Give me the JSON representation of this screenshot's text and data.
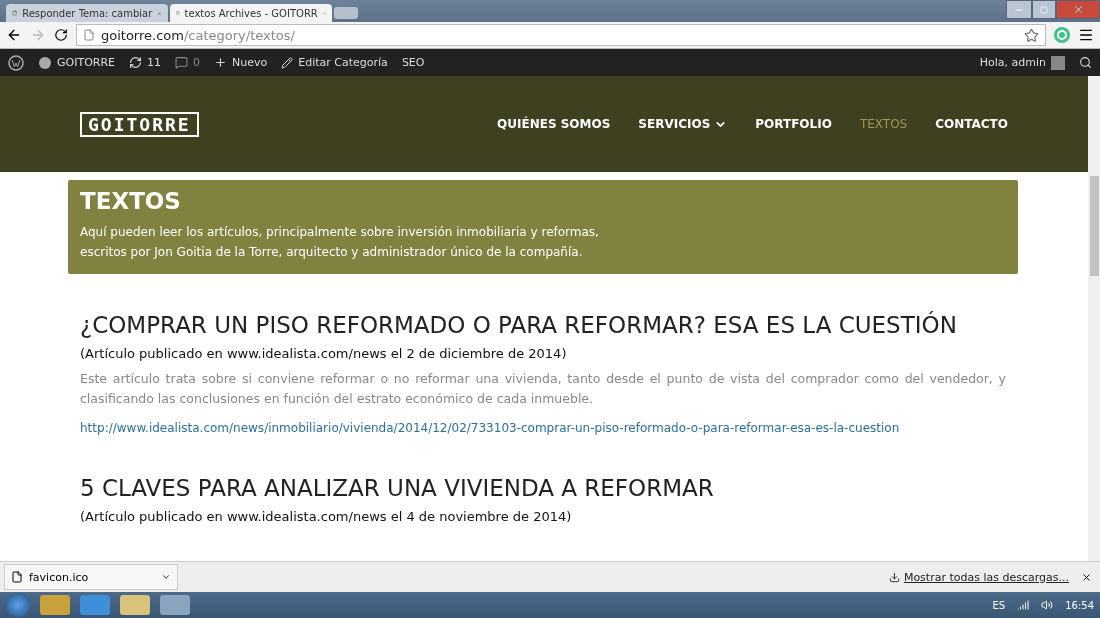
{
  "browser": {
    "tabs": [
      {
        "title": "Responder Tema: cambiar",
        "selected": false
      },
      {
        "title": "textos Archives - GOITORR",
        "selected": true
      }
    ],
    "url_host": "goitorre.com",
    "url_path": "/category/textos/"
  },
  "admin_bar": {
    "site": "GOITORRE",
    "updates": "11",
    "comments": "0",
    "new": "Nuevo",
    "edit": "Editar Categoría",
    "seo": "SEO",
    "greeting": "Hola, admin"
  },
  "header": {
    "logo": "GOITORRE",
    "nav": [
      {
        "label": "QUIÉNES SOMOS",
        "selected": false,
        "dropdown": false
      },
      {
        "label": "SERVICIOS",
        "selected": false,
        "dropdown": true
      },
      {
        "label": "PORTFOLIO",
        "selected": false,
        "dropdown": false
      },
      {
        "label": "TEXTOS",
        "selected": true,
        "dropdown": false
      },
      {
        "label": "CONTACTO",
        "selected": false,
        "dropdown": false
      }
    ]
  },
  "banner": {
    "title": "TEXTOS",
    "lines": [
      "Aquí pueden leer los artículos, principalmente sobre inversión inmobiliaria y reformas,",
      "escritos por Jon Goitia de la Torre, arquitecto y administrador único de la compañía."
    ]
  },
  "articles": [
    {
      "title": "¿COMPRAR UN PISO REFORMADO O PARA REFORMAR? ESA ES LA CUESTIÓN",
      "subtitle": "(Artículo publicado en www.idealista.com/news el 2 de diciembre de 2014)",
      "summary": "Este artículo trata sobre si conviene reformar o no reformar una vivienda, tanto desde el punto de vista del comprador como del vendedor, y clasificando las conclusiones en función del estrato económico de cada inmueble.",
      "link": "http://www.idealista.com/news/inmobiliario/vivienda/2014/12/02/733103-comprar-un-piso-reformado-o-para-reformar-esa-es-la-cuestion"
    },
    {
      "title": "5 CLAVES PARA ANALIZAR UNA VIVIENDA A REFORMAR",
      "subtitle": "(Artículo publicado en www.idealista.com/news el 4 de noviembre de 2014)"
    }
  ],
  "download_bar": {
    "file": "favicon.ico",
    "show_all": "Mostrar todas las descargas..."
  },
  "taskbar": {
    "language": "ES",
    "time": "16:54"
  }
}
